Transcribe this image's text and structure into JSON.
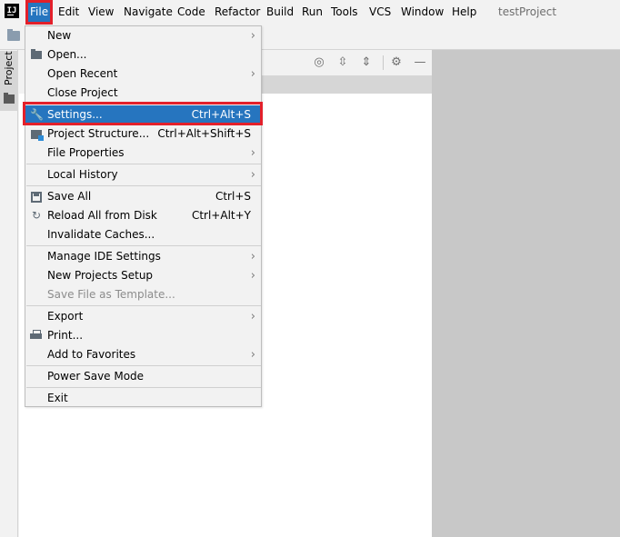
{
  "menubar": {
    "items": [
      {
        "label": "File",
        "key": "file"
      },
      {
        "label": "Edit",
        "key": "edit"
      },
      {
        "label": "View",
        "key": "view"
      },
      {
        "label": "Navigate",
        "key": "navigate"
      },
      {
        "label": "Code",
        "key": "code"
      },
      {
        "label": "Refactor",
        "key": "refactor"
      },
      {
        "label": "Build",
        "key": "build"
      },
      {
        "label": "Run",
        "key": "run"
      },
      {
        "label": "Tools",
        "key": "tools"
      },
      {
        "label": "VCS",
        "key": "vcs"
      },
      {
        "label": "Window",
        "key": "window"
      },
      {
        "label": "Help",
        "key": "help"
      }
    ],
    "window_title": "testProject",
    "active_color": "#2675bf",
    "highlight_color": "#e3202a"
  },
  "tool_strip": {
    "project_tab": "Project"
  },
  "file_menu": {
    "items": [
      {
        "label": "New",
        "shortcut": "",
        "submenu": true
      },
      {
        "label": "Open...",
        "shortcut": "",
        "icon": "folder-open-icon"
      },
      {
        "label": "Open Recent",
        "shortcut": "",
        "submenu": true
      },
      {
        "label": "Close Project",
        "shortcut": ""
      },
      {
        "label": "Settings...",
        "shortcut": "Ctrl+Alt+S",
        "icon": "wrench-icon",
        "selected": true
      },
      {
        "label": "Project Structure...",
        "shortcut": "Ctrl+Alt+Shift+S",
        "icon": "project-structure-icon"
      },
      {
        "label": "File Properties",
        "shortcut": "",
        "submenu": true
      },
      {
        "label": "Local History",
        "shortcut": "",
        "submenu": true
      },
      {
        "label": "Save All",
        "shortcut": "Ctrl+S",
        "icon": "save-icon"
      },
      {
        "label": "Reload All from Disk",
        "shortcut": "Ctrl+Alt+Y",
        "icon": "reload-icon"
      },
      {
        "label": "Invalidate Caches...",
        "shortcut": ""
      },
      {
        "label": "Manage IDE Settings",
        "shortcut": "",
        "submenu": true
      },
      {
        "label": "New Projects Setup",
        "shortcut": "",
        "submenu": true
      },
      {
        "label": "Save File as Template...",
        "shortcut": "",
        "disabled": true
      },
      {
        "label": "Export",
        "shortcut": "",
        "submenu": true
      },
      {
        "label": "Print...",
        "shortcut": "",
        "icon": "print-icon"
      },
      {
        "label": "Add to Favorites",
        "shortcut": "",
        "submenu": true
      },
      {
        "label": "Power Save Mode",
        "shortcut": ""
      },
      {
        "label": "Exit",
        "shortcut": ""
      }
    ]
  }
}
